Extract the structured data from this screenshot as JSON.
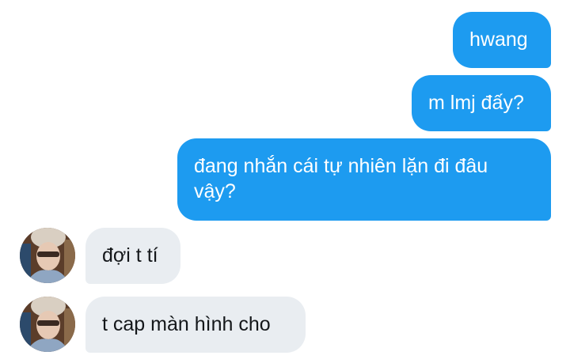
{
  "conversation": {
    "messages": [
      {
        "direction": "sent",
        "text": "hwang"
      },
      {
        "direction": "sent",
        "text": "m lmj đấy?"
      },
      {
        "direction": "sent",
        "text": "đang nhắn cái tự nhiên lặn đi đâu vậy?"
      },
      {
        "direction": "received",
        "text": "đợi t tí"
      },
      {
        "direction": "received",
        "text": "t cap màn hình cho"
      }
    ]
  },
  "colors": {
    "sent_bubble": "#1d9bf0",
    "received_bubble": "#e9edf1",
    "sent_text": "#ffffff",
    "received_text": "#14171a"
  },
  "icons": {
    "contact_avatar": "avatar-photo"
  }
}
